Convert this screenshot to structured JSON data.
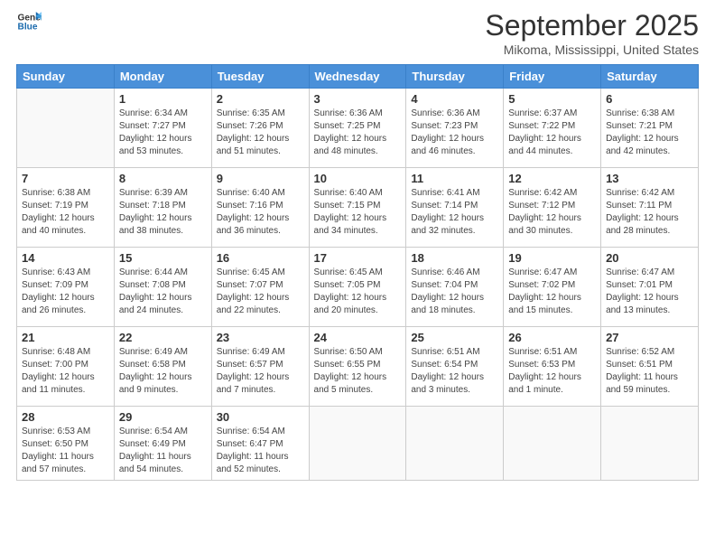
{
  "logo": {
    "line1": "General",
    "line2": "Blue"
  },
  "title": "September 2025",
  "subtitle": "Mikoma, Mississippi, United States",
  "days": [
    "Sunday",
    "Monday",
    "Tuesday",
    "Wednesday",
    "Thursday",
    "Friday",
    "Saturday"
  ],
  "weeks": [
    [
      {
        "num": "",
        "sunrise": "",
        "sunset": "",
        "daylight": ""
      },
      {
        "num": "1",
        "sunrise": "6:34 AM",
        "sunset": "7:27 PM",
        "hours": "12 hours and 53 minutes."
      },
      {
        "num": "2",
        "sunrise": "6:35 AM",
        "sunset": "7:26 PM",
        "hours": "12 hours and 51 minutes."
      },
      {
        "num": "3",
        "sunrise": "6:36 AM",
        "sunset": "7:25 PM",
        "hours": "12 hours and 48 minutes."
      },
      {
        "num": "4",
        "sunrise": "6:36 AM",
        "sunset": "7:23 PM",
        "hours": "12 hours and 46 minutes."
      },
      {
        "num": "5",
        "sunrise": "6:37 AM",
        "sunset": "7:22 PM",
        "hours": "12 hours and 44 minutes."
      },
      {
        "num": "6",
        "sunrise": "6:38 AM",
        "sunset": "7:21 PM",
        "hours": "12 hours and 42 minutes."
      }
    ],
    [
      {
        "num": "7",
        "sunrise": "6:38 AM",
        "sunset": "7:19 PM",
        "hours": "12 hours and 40 minutes."
      },
      {
        "num": "8",
        "sunrise": "6:39 AM",
        "sunset": "7:18 PM",
        "hours": "12 hours and 38 minutes."
      },
      {
        "num": "9",
        "sunrise": "6:40 AM",
        "sunset": "7:16 PM",
        "hours": "12 hours and 36 minutes."
      },
      {
        "num": "10",
        "sunrise": "6:40 AM",
        "sunset": "7:15 PM",
        "hours": "12 hours and 34 minutes."
      },
      {
        "num": "11",
        "sunrise": "6:41 AM",
        "sunset": "7:14 PM",
        "hours": "12 hours and 32 minutes."
      },
      {
        "num": "12",
        "sunrise": "6:42 AM",
        "sunset": "7:12 PM",
        "hours": "12 hours and 30 minutes."
      },
      {
        "num": "13",
        "sunrise": "6:42 AM",
        "sunset": "7:11 PM",
        "hours": "12 hours and 28 minutes."
      }
    ],
    [
      {
        "num": "14",
        "sunrise": "6:43 AM",
        "sunset": "7:09 PM",
        "hours": "12 hours and 26 minutes."
      },
      {
        "num": "15",
        "sunrise": "6:44 AM",
        "sunset": "7:08 PM",
        "hours": "12 hours and 24 minutes."
      },
      {
        "num": "16",
        "sunrise": "6:45 AM",
        "sunset": "7:07 PM",
        "hours": "12 hours and 22 minutes."
      },
      {
        "num": "17",
        "sunrise": "6:45 AM",
        "sunset": "7:05 PM",
        "hours": "12 hours and 20 minutes."
      },
      {
        "num": "18",
        "sunrise": "6:46 AM",
        "sunset": "7:04 PM",
        "hours": "12 hours and 18 minutes."
      },
      {
        "num": "19",
        "sunrise": "6:47 AM",
        "sunset": "7:02 PM",
        "hours": "12 hours and 15 minutes."
      },
      {
        "num": "20",
        "sunrise": "6:47 AM",
        "sunset": "7:01 PM",
        "hours": "12 hours and 13 minutes."
      }
    ],
    [
      {
        "num": "21",
        "sunrise": "6:48 AM",
        "sunset": "7:00 PM",
        "hours": "12 hours and 11 minutes."
      },
      {
        "num": "22",
        "sunrise": "6:49 AM",
        "sunset": "6:58 PM",
        "hours": "12 hours and 9 minutes."
      },
      {
        "num": "23",
        "sunrise": "6:49 AM",
        "sunset": "6:57 PM",
        "hours": "12 hours and 7 minutes."
      },
      {
        "num": "24",
        "sunrise": "6:50 AM",
        "sunset": "6:55 PM",
        "hours": "12 hours and 5 minutes."
      },
      {
        "num": "25",
        "sunrise": "6:51 AM",
        "sunset": "6:54 PM",
        "hours": "12 hours and 3 minutes."
      },
      {
        "num": "26",
        "sunrise": "6:51 AM",
        "sunset": "6:53 PM",
        "hours": "12 hours and 1 minute."
      },
      {
        "num": "27",
        "sunrise": "6:52 AM",
        "sunset": "6:51 PM",
        "hours": "11 hours and 59 minutes."
      }
    ],
    [
      {
        "num": "28",
        "sunrise": "6:53 AM",
        "sunset": "6:50 PM",
        "hours": "11 hours and 57 minutes."
      },
      {
        "num": "29",
        "sunrise": "6:54 AM",
        "sunset": "6:49 PM",
        "hours": "11 hours and 54 minutes."
      },
      {
        "num": "30",
        "sunrise": "6:54 AM",
        "sunset": "6:47 PM",
        "hours": "11 hours and 52 minutes."
      },
      {
        "num": "",
        "sunrise": "",
        "sunset": "",
        "hours": ""
      },
      {
        "num": "",
        "sunrise": "",
        "sunset": "",
        "hours": ""
      },
      {
        "num": "",
        "sunrise": "",
        "sunset": "",
        "hours": ""
      },
      {
        "num": "",
        "sunrise": "",
        "sunset": "",
        "hours": ""
      }
    ]
  ]
}
